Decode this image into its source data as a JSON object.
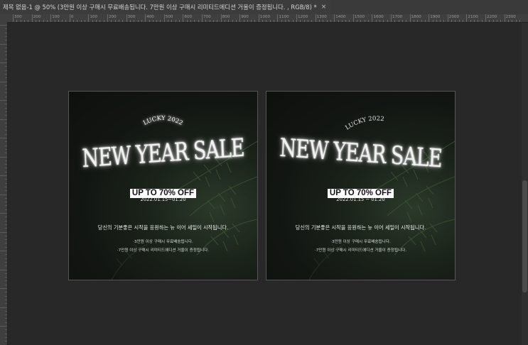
{
  "document_tab": {
    "title": "제목 없음-1 @ 50% (3만원 이상 구매시 무료배송됩니다. 7만원 이상 구매시 리미티드에디션 거울이 증정됩니다. , RGB/8) *",
    "close_label": "×"
  },
  "ruler": {
    "labels": [
      "300",
      "200",
      "100",
      "0",
      "100",
      "200",
      "300",
      "400",
      "500",
      "600",
      "700",
      "800",
      "900",
      "1000",
      "1100",
      "1200",
      "1300",
      "1400",
      "1500",
      "1600",
      "1700",
      "1800",
      "1900",
      "2000",
      "2100",
      "2200",
      "2300"
    ]
  },
  "artboards": [
    {
      "lucky": "LUCKY 2022",
      "headline": "NEW YEAR SALE",
      "offer": "UP TO 70% OFF",
      "dates": "2022.01.15~01.20",
      "tagline": "당신의 기분좋은 시작을 응원하는 뉴 이어 세일이 시작됩니다.",
      "bullet1": "·3만원 이상 구매시 무료배송됩니다.",
      "bullet2": "·7만원 이상 구매시 리미티드에디션 거울이 증정됩니다."
    },
    {
      "lucky": "LUCKY 2022",
      "headline": "NEW YEAR SALE",
      "offer": "UP TO 70% OFF",
      "dates": "2022.01.15 ~ 01.20",
      "tagline": "당신의 기분좋은 시작을 응원하는 뉴 이어 세일이 시작됩니다.",
      "bullet1": "·3만원 이상 구매시 무료배송됩니다.",
      "bullet2": "·7만원 이상 구매시 리미티드에디션 거울이 증정됩니다."
    }
  ]
}
